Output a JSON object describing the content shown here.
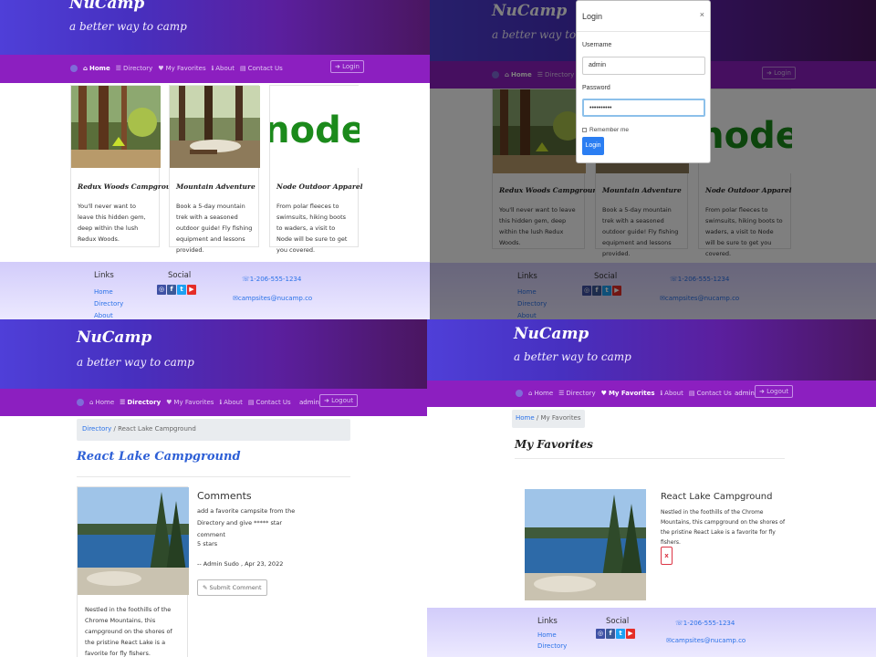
{
  "brand": "NuCamp",
  "tagline": "a better way to camp",
  "nav": {
    "home": "Home",
    "directory": "Directory",
    "favorites": "My Favorites",
    "about": "About",
    "contact": "Contact Us",
    "login": "Login",
    "logout": "Logout",
    "user": "admin"
  },
  "cards": [
    {
      "title": "Redux Woods Campground",
      "text": "You'll never want to leave this hidden gem, deep within the lush Redux Woods."
    },
    {
      "title": "Mountain Adventure",
      "text": "Book a 5-day mountain trek with a seasoned outdoor guide! Fly fishing equipment and lessons provided."
    },
    {
      "title": "Node Outdoor Apparel",
      "text": "From polar fleeces to swimsuits, hiking boots to waders, a visit to Node will be sure to get you covered."
    }
  ],
  "node_logo": "node",
  "footer": {
    "links_title": "Links",
    "links": [
      "Home",
      "Directory",
      "About"
    ],
    "social_title": "Social",
    "phone": "1-206-555-1234",
    "email": "campsites@nucamp.co"
  },
  "login_modal": {
    "title": "Login",
    "close": "×",
    "username_label": "Username",
    "username_value": "admin",
    "password_label": "Password",
    "password_value": "••••••••••",
    "remember": "Remember me",
    "submit": "Login"
  },
  "campsite_page": {
    "breadcrumb_link": "Directory",
    "breadcrumb_current": "React Lake Campground",
    "heading": "React Lake Campground",
    "description": "Nestled in the foothills of the Chrome Mountains, this campground on the shores of the pristine React Lake is a favorite for fly fishers.",
    "comments_title": "Comments",
    "comment_text": "add a favorite campsite from the Directory and give ***** star comment",
    "comment_rating": "5 stars",
    "comment_author": "-- Admin Sudo , Apr 23, 2022",
    "submit_comment": "Submit Comment"
  },
  "favorites_page": {
    "breadcrumb_link": "Home",
    "breadcrumb_current": "My Favorites",
    "heading": "My Favorites",
    "item_title": "React Lake Campground",
    "item_text": "Nestled in the foothills of the Chrome Mountains, this campground on the shores of the pristine React Lake is a favorite for fly fishers.",
    "remove": "x"
  },
  "colors": {
    "jumbotron_start": "#4f3fd8",
    "jumbotron_end": "#4a1660",
    "navbar": "#8c1fc0",
    "link": "#2a72e8",
    "heading_blue": "#2d5fd6",
    "footer_start": "#d2ccfa",
    "footer_end": "#ece9ff",
    "login_button": "#2b7ef2",
    "remove_red": "#dc3545"
  }
}
